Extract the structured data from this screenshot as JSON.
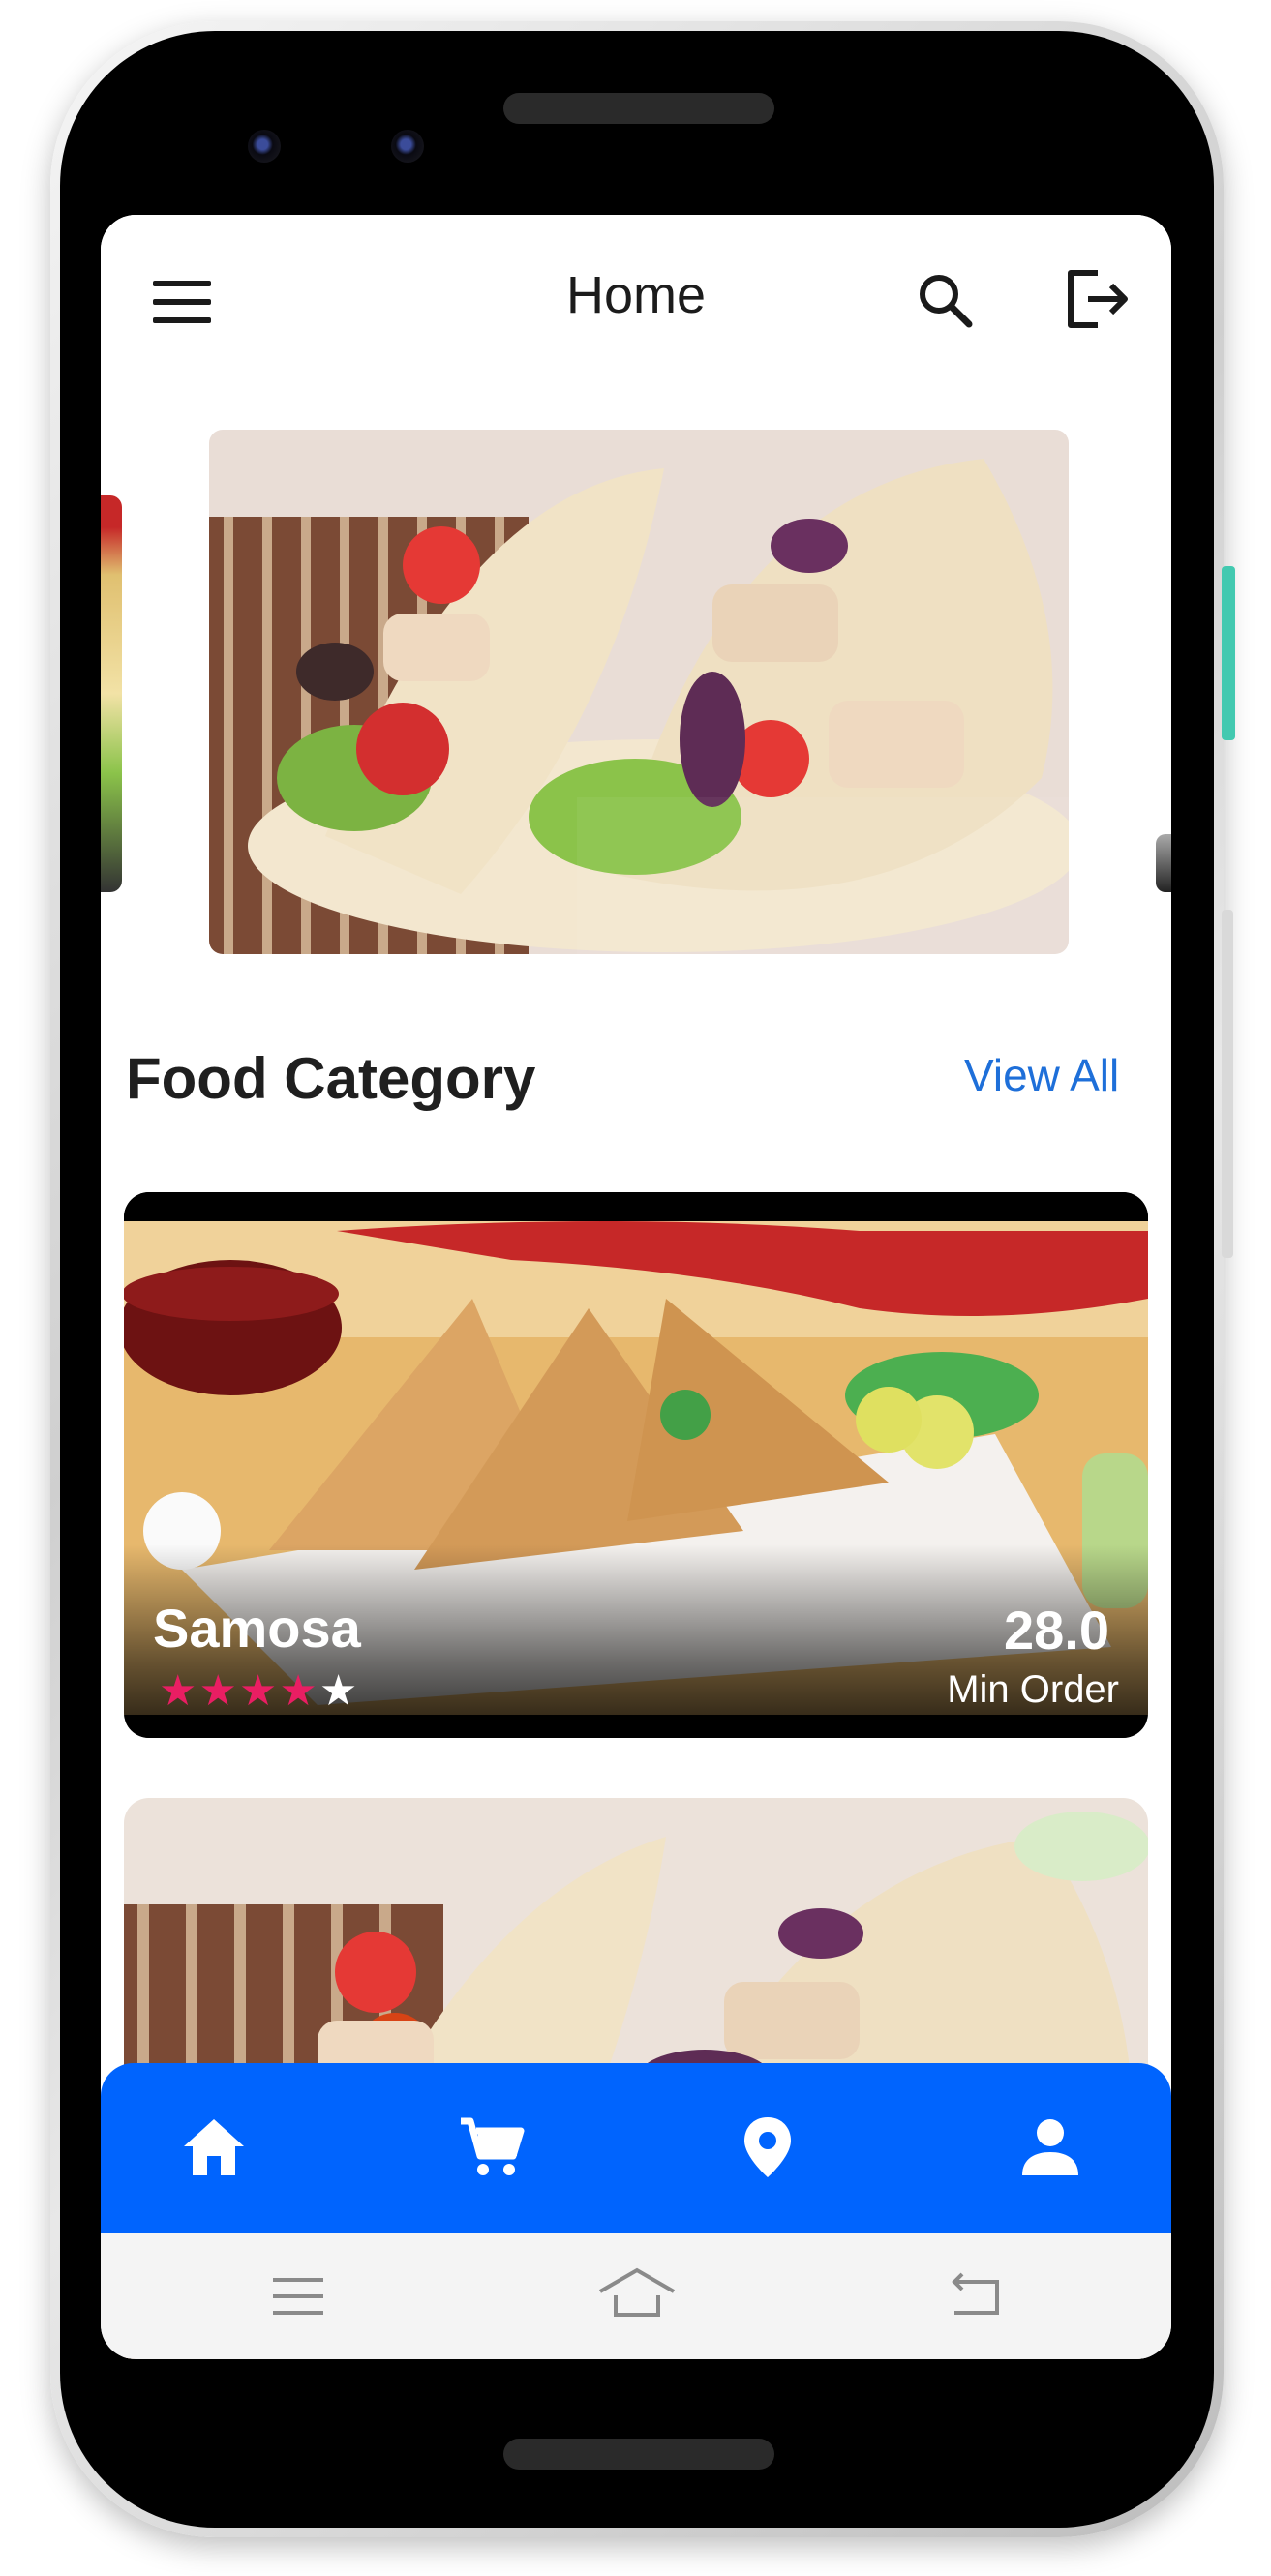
{
  "app": {
    "title": "Home"
  },
  "header": {
    "menu_icon": "hamburger-menu-icon",
    "search_icon": "search-icon",
    "logout_icon": "logout-icon"
  },
  "section": {
    "title": "Food Category",
    "view_all": "View All"
  },
  "cards": [
    {
      "name": "Samosa",
      "rating": 4,
      "rating_max": 5,
      "min_order_value": "28.0",
      "min_order_label": "Min Order"
    }
  ],
  "bottom_nav": [
    {
      "icon": "home-icon"
    },
    {
      "icon": "cart-icon"
    },
    {
      "icon": "location-pin-icon"
    },
    {
      "icon": "person-icon"
    }
  ],
  "colors": {
    "accent": "#0064fe",
    "link": "#1e6fd9",
    "star": "#e91e63"
  }
}
